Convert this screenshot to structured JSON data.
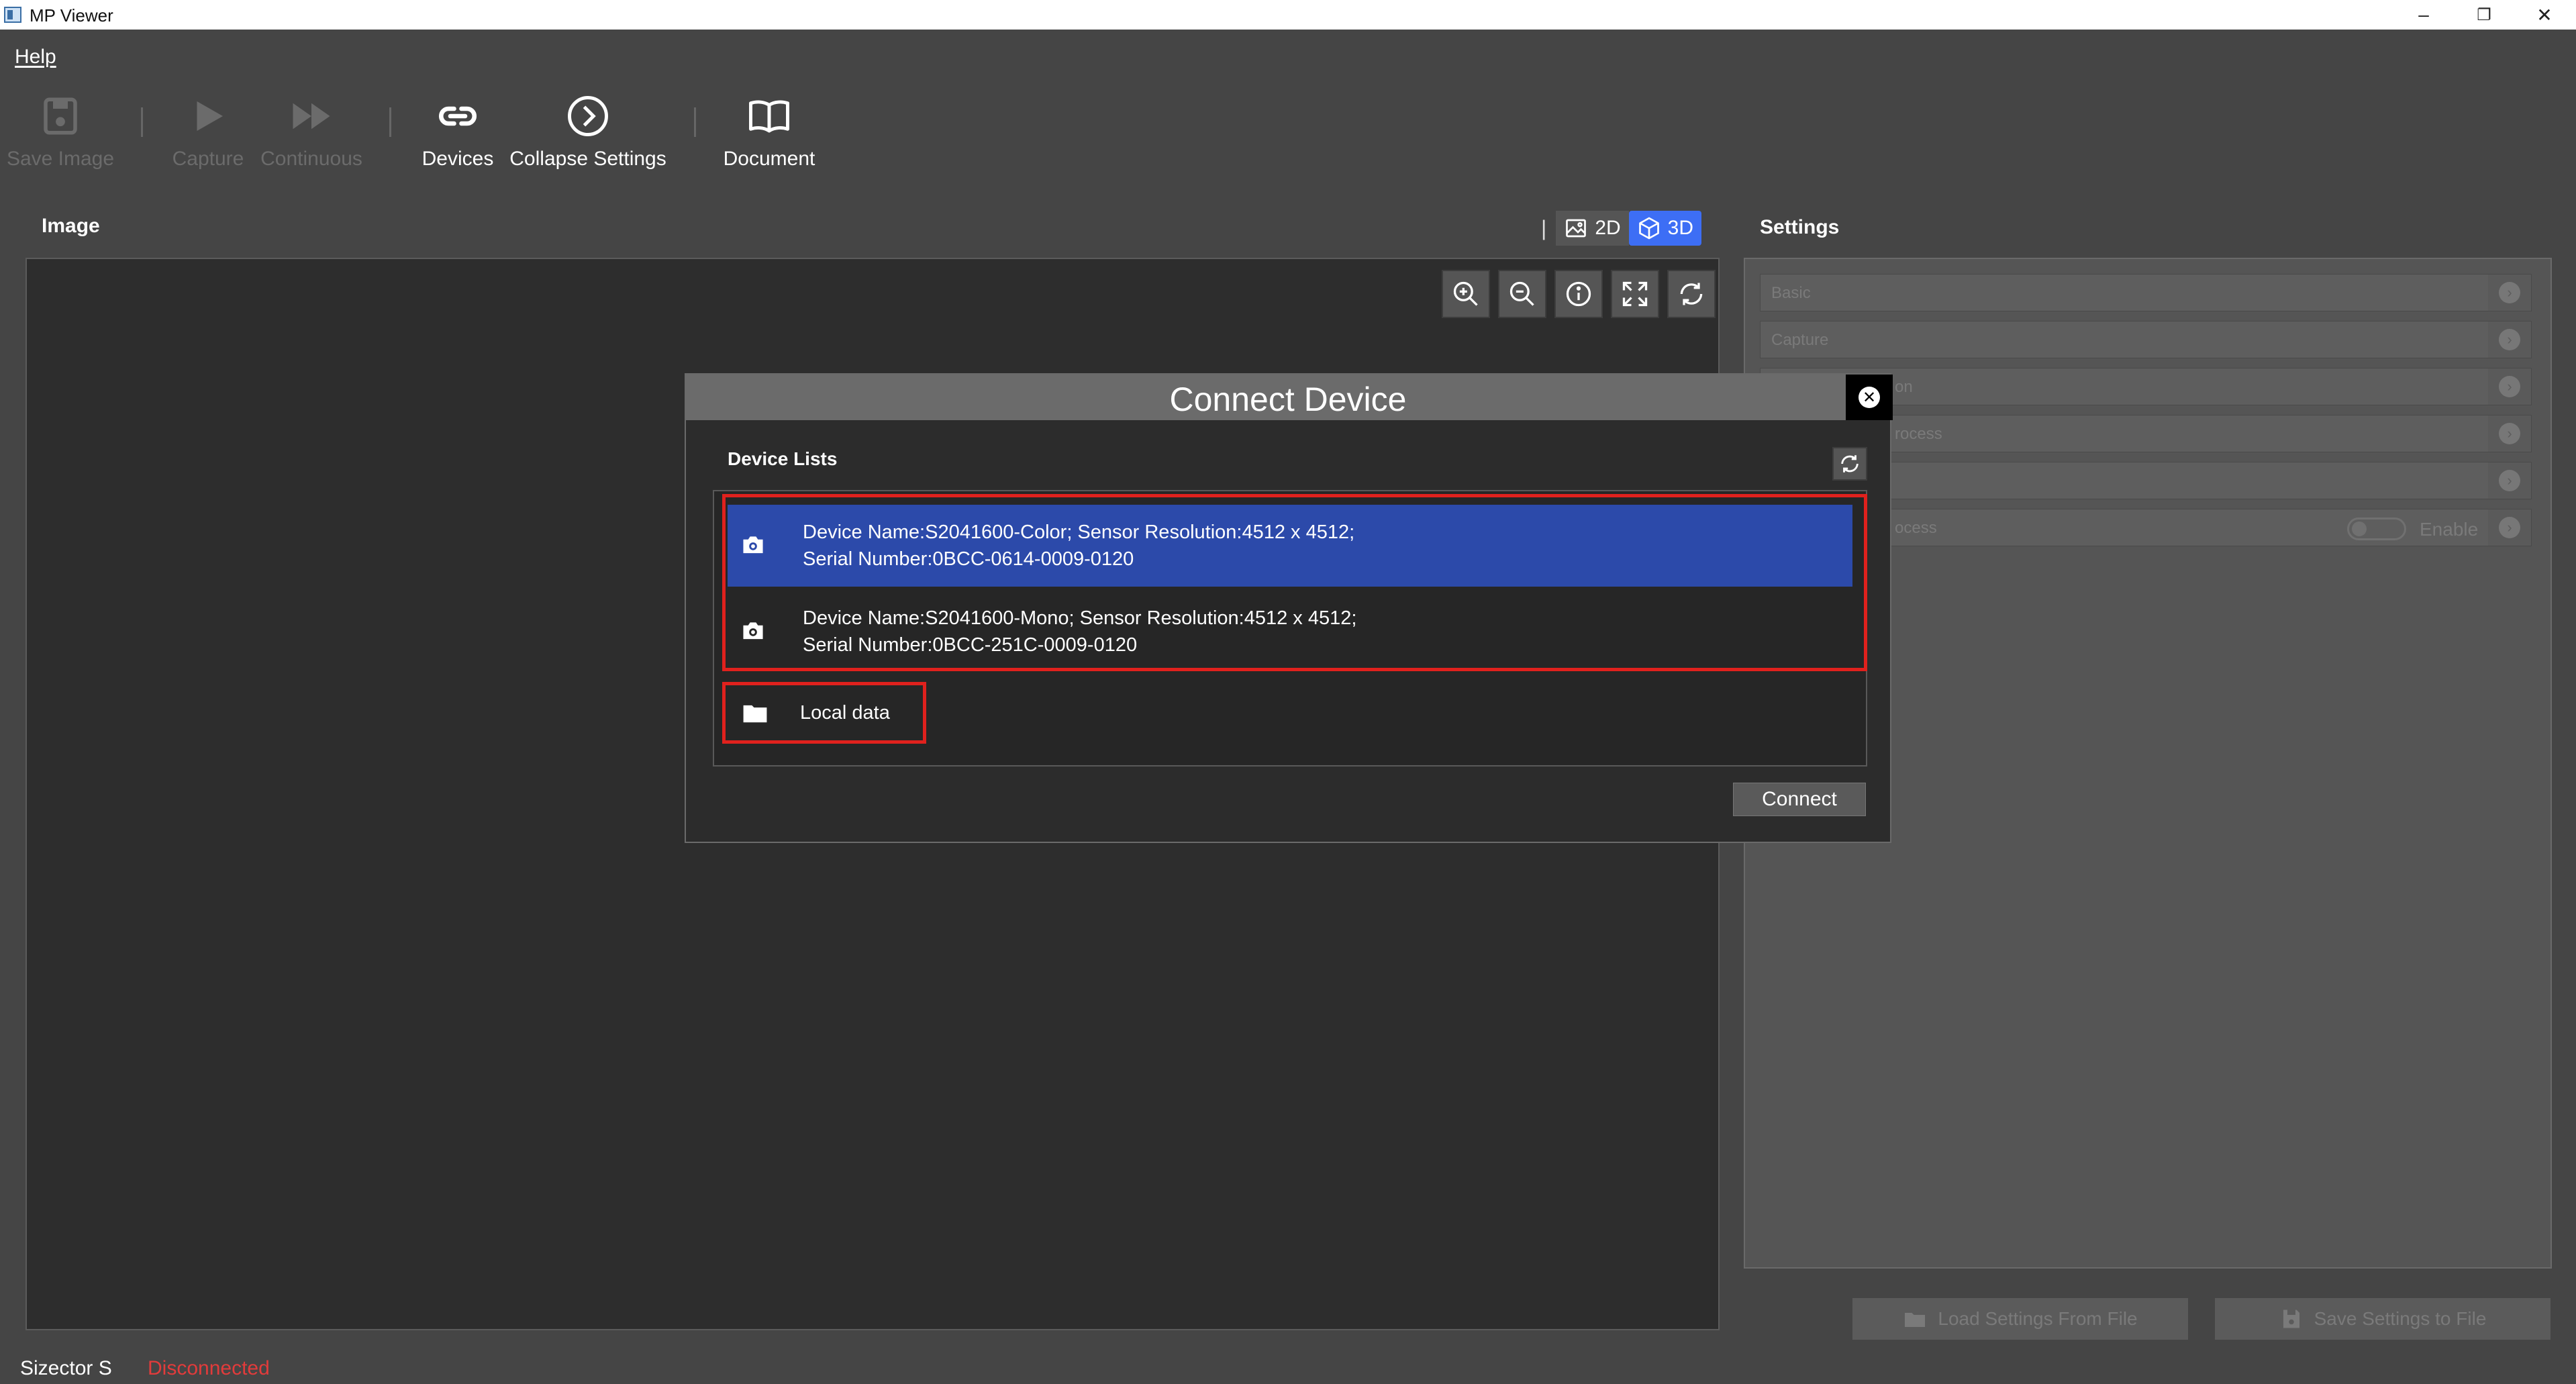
{
  "window": {
    "title": "MP Viewer",
    "minimize_glyph": "–",
    "restore_glyph": "❐",
    "close_glyph": "✕"
  },
  "menu": {
    "help": "Help"
  },
  "toolbar": {
    "save_image": "Save Image",
    "capture": "Capture",
    "continuous": "Continuous",
    "devices": "Devices",
    "collapse_settings": "Collapse Settings",
    "document": "Document"
  },
  "image_panel": {
    "title": "Image",
    "view_separator": "|",
    "view_2d": "2D",
    "view_3d": "3D",
    "active_view": "3D"
  },
  "settings": {
    "title": "Settings",
    "sections": [
      "Basic",
      "Capture",
      "on",
      "rocess",
      "",
      "ocess"
    ],
    "enable_label": "Enable",
    "load_button": "Load Settings From File",
    "save_button": "Save Settings to File"
  },
  "status": {
    "device": "Sizector S",
    "connection": "Disconnected",
    "connection_color": "#e23b3b"
  },
  "dialog": {
    "title": "Connect Device",
    "close_glyph": "✕",
    "device_lists_label": "Device Lists",
    "devices": [
      {
        "line1": "Device Name:S2041600-Color; Sensor Resolution:4512 x 4512;",
        "line2": "Serial Number:0BCC-0614-0009-0120",
        "selected": true
      },
      {
        "line1": "Device Name:S2041600-Mono; Sensor Resolution:4512 x 4512;",
        "line2": "Serial Number:0BCC-251C-0009-0120",
        "selected": false
      }
    ],
    "local_data": "Local data",
    "connect_button": "Connect"
  },
  "colors": {
    "accent": "#3d6ef5",
    "selection": "#2c4aaa",
    "highlight_box": "#e0211d"
  }
}
